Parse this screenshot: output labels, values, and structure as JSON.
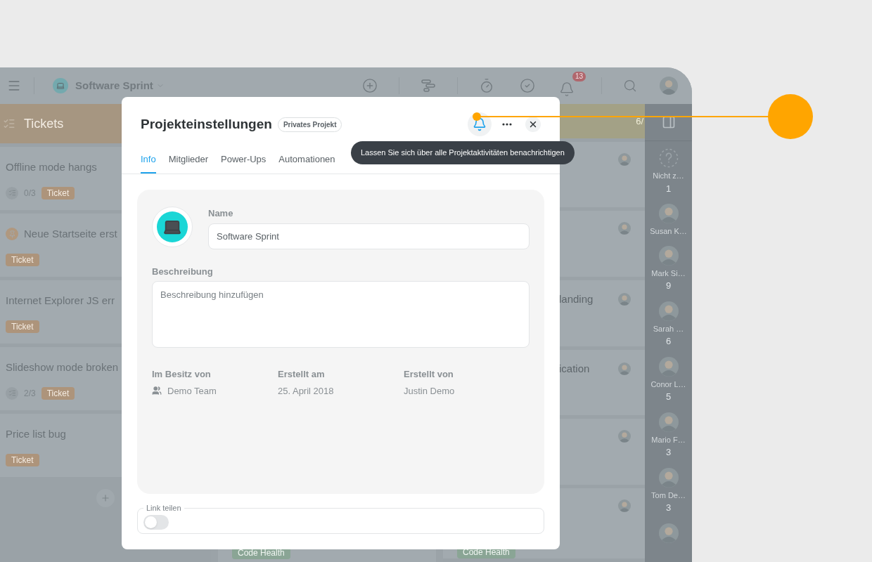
{
  "topbar": {
    "project": "Software Sprint",
    "notification_count": "13"
  },
  "board": {
    "columns": [
      {
        "kind": "tickets",
        "title": "Tickets",
        "cards": [
          {
            "title": "Offline mode hangs",
            "pinned": false,
            "checklist": "0/3",
            "tag": "Ticket"
          },
          {
            "title": "Neue Startseite erst",
            "pinned": true,
            "tag": "Ticket"
          },
          {
            "title": "Internet Explorer JS err",
            "pinned": false,
            "tag": "Ticket"
          },
          {
            "title": "Slideshow mode broken",
            "pinned": false,
            "checklist": "2/3",
            "tag": "Ticket"
          },
          {
            "title": "Price list bug",
            "pinned": false,
            "tag": "Ticket"
          }
        ]
      },
      {
        "kind": "hidden",
        "cards": [
          {
            "tag": "Code Health"
          }
        ]
      },
      {
        "kind": "counted",
        "count": "6/",
        "cards": [
          {
            "kind": "plain"
          },
          {
            "kind": "plain"
          },
          {
            "kind": "titled",
            "title": "landing"
          },
          {
            "kind": "titled",
            "title": "ication"
          },
          {
            "kind": "plain"
          },
          {
            "kind": "tagged",
            "tag": "Code Health"
          }
        ]
      }
    ]
  },
  "people": [
    {
      "name": "Nicht z…",
      "count": "1",
      "kind": "unassigned"
    },
    {
      "name": "Susan K…",
      "kind": "person"
    },
    {
      "name": "Mark Si…",
      "count": "9",
      "kind": "person"
    },
    {
      "name": "Sarah …",
      "count": "6",
      "kind": "person"
    },
    {
      "name": "Conor L…",
      "count": "5",
      "kind": "person"
    },
    {
      "name": "Mario F…",
      "count": "3",
      "kind": "person"
    },
    {
      "name": "Tom De…",
      "count": "3",
      "kind": "person"
    },
    {
      "kind": "person"
    }
  ],
  "modal": {
    "title": "Projekteinstellungen",
    "badge": "Privates Projekt",
    "tooltip": "Lassen Sie sich über alle Projektaktivitäten benachrichtigen",
    "tabs": [
      {
        "label": "Info",
        "selected": true
      },
      {
        "label": "Mitglieder",
        "selected": false
      },
      {
        "label": "Power-Ups",
        "selected": false
      },
      {
        "label": "Automationen",
        "selected": false
      }
    ],
    "name_label": "Name",
    "name_value": "Software Sprint",
    "description_label": "Beschreibung",
    "description_placeholder": "Beschreibung hinzufügen",
    "meta": [
      {
        "label": "Im Besitz von",
        "value": "Demo Team",
        "kind": "team"
      },
      {
        "label": "Erstellt am",
        "value": "25. April 2018",
        "kind": "text"
      },
      {
        "label": "Erstellt von",
        "value": "Justin Demo",
        "kind": "text"
      }
    ],
    "share": {
      "legend": "Link teilen",
      "on": false
    }
  }
}
